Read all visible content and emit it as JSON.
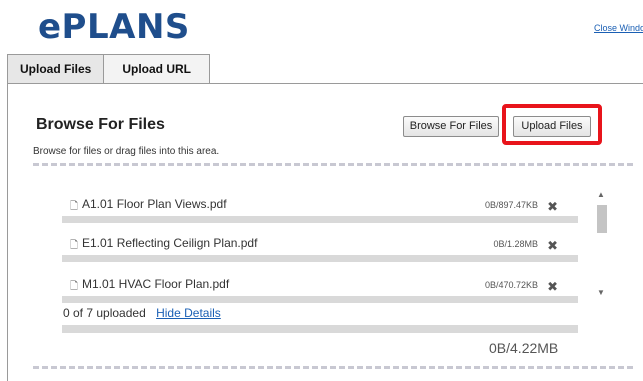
{
  "header": {
    "logo": "ePLANS",
    "close_link": "Close Windo"
  },
  "tabs": [
    {
      "label": "Upload Files",
      "active": true
    },
    {
      "label": "Upload URL",
      "active": false
    }
  ],
  "browse": {
    "title": "Browse For Files",
    "help_text": "Browse for files or drag files into this area.",
    "browse_button": "Browse For Files",
    "upload_button": "Upload Files",
    "highlight_color": "#e8141b"
  },
  "files": [
    {
      "icon": "document-icon",
      "name": "A1.01 Floor Plan Views.pdf",
      "size": "0B/897.47KB",
      "remove": "✖"
    },
    {
      "icon": "document-icon",
      "name": "E1.01 Reflecting Ceilign Plan.pdf",
      "size": "0B/1.28MB",
      "remove": "✖"
    },
    {
      "icon": "document-icon",
      "name": "M1.01 HVAC Floor Plan.pdf",
      "size": "0B/470.72KB",
      "remove": "✖"
    }
  ],
  "status": {
    "uploaded_text": "0 of 7 uploaded",
    "hide_details": "Hide Details",
    "total_size": "0B/4.22MB"
  },
  "icons": {
    "file_glyph": "🗋",
    "scroll_up": "▲",
    "scroll_down": "▼"
  }
}
